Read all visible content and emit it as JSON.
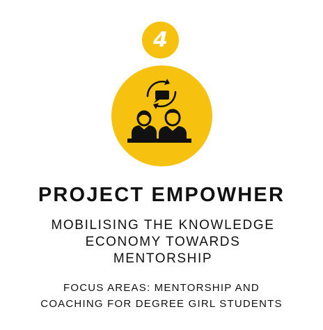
{
  "colors": {
    "accent": "#F6C20F",
    "text": "#111111",
    "background": "#FFFFFF",
    "icon_dark": "#111111",
    "badge_text": "#FFFFFF"
  },
  "step": {
    "number": "4"
  },
  "hero": {
    "icon": "mentorship-people-icon"
  },
  "title": "PROJECT EMPOWHER",
  "subtitle": {
    "lines": [
      "MOBILISING THE KNOWLEDGE",
      "ECONOMY TOWARDS",
      "MENTORSHIP"
    ]
  },
  "focus": {
    "lines": [
      "FOCUS AREAS: MENTORSHIP AND",
      "COACHING FOR DEGREE GIRL STUDENTS"
    ]
  }
}
